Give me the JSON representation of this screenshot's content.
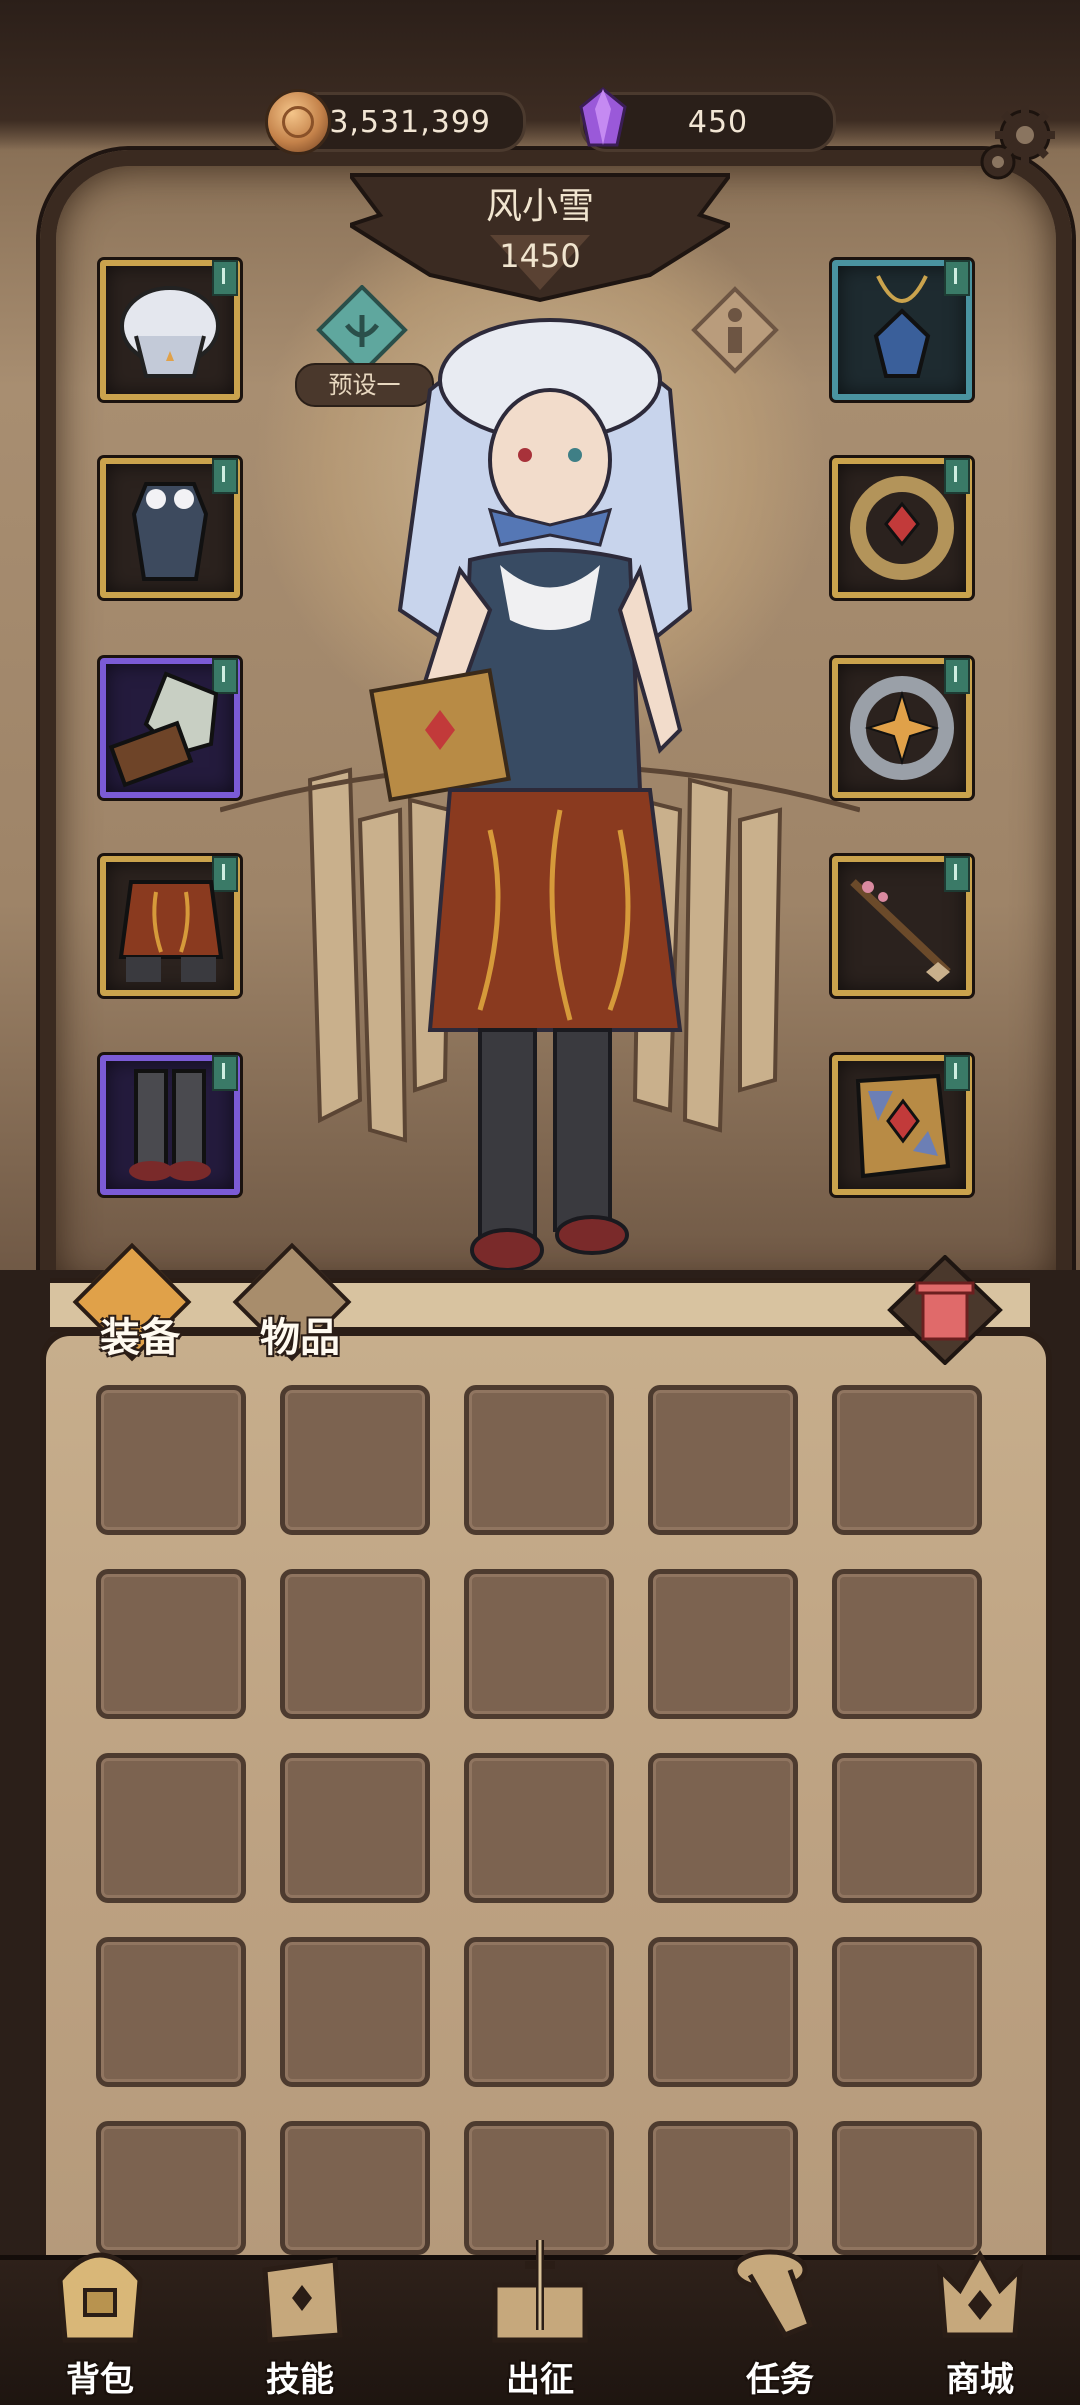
{
  "currency": {
    "gold": "3,531,399",
    "gems": "450",
    "gold_icon": "coin-icon",
    "gem_icon": "purple-crystal-icon"
  },
  "hero": {
    "name": "风小雪",
    "power": "1450",
    "preset_label": "预设一"
  },
  "equipment": {
    "left": [
      {
        "slot": "helmet",
        "rarity": "gold"
      },
      {
        "slot": "armor",
        "rarity": "gold"
      },
      {
        "slot": "gloves",
        "rarity": "purple"
      },
      {
        "slot": "pants",
        "rarity": "gold"
      },
      {
        "slot": "boots",
        "rarity": "purple"
      }
    ],
    "right": [
      {
        "slot": "necklace",
        "rarity": "teal"
      },
      {
        "slot": "ring-1",
        "rarity": "gold"
      },
      {
        "slot": "ring-2",
        "rarity": "gold"
      },
      {
        "slot": "weapon",
        "rarity": "gold"
      },
      {
        "slot": "book",
        "rarity": "gold"
      }
    ]
  },
  "bag": {
    "tabs": [
      {
        "label": "装备",
        "active": true
      },
      {
        "label": "物品",
        "active": false
      }
    ],
    "rows": 5,
    "cols": 5
  },
  "bottom_nav": [
    {
      "label": "背包",
      "icon": "backpack-icon"
    },
    {
      "label": "技能",
      "icon": "skill-book-icon"
    },
    {
      "label": "出征",
      "icon": "map-sword-icon"
    },
    {
      "label": "任务",
      "icon": "scroll-icon"
    },
    {
      "label": "商城",
      "icon": "shop-crown-icon"
    }
  ],
  "colors": {
    "gold_border": "#caa34d",
    "purple_border": "#7b5bd6",
    "teal_border": "#4a93a0",
    "active_tab": "#e0a149"
  }
}
